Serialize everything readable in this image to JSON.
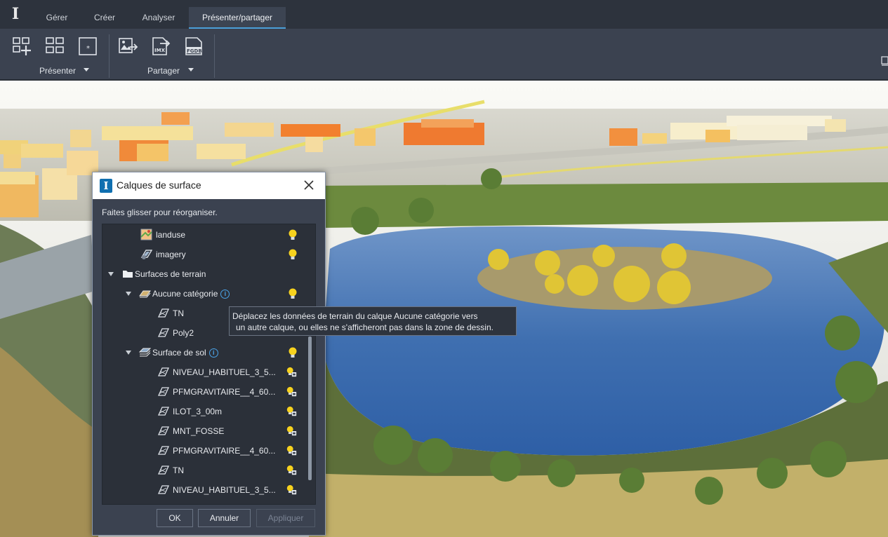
{
  "app": {
    "logo": "I"
  },
  "tabs": [
    {
      "label": "Gérer",
      "active": false
    },
    {
      "label": "Créer",
      "active": false
    },
    {
      "label": "Analyser",
      "active": false
    },
    {
      "label": "Présenter/partager",
      "active": true
    }
  ],
  "ribbon": {
    "groups": [
      {
        "label": "Présenter",
        "buttons": [
          "add-view-icon",
          "view-grid-icon",
          "snapshot-icon"
        ]
      },
      {
        "label": "Partager",
        "buttons": [
          "export-image-icon",
          "export-imx-icon",
          "export-fgdb-icon"
        ]
      }
    ],
    "imx_text": "IMX",
    "fgdb_text": "FGDB"
  },
  "dialog": {
    "title": "Calques de surface",
    "hint": "Faites glisser pour réorganiser.",
    "tree": [
      {
        "label": "landuse",
        "icon": "landuse-icon",
        "bulb": "on"
      },
      {
        "label": "imagery",
        "icon": "imagery-icon",
        "bulb": "on"
      },
      {
        "label": "Surfaces de terrain",
        "icon": "folder-icon",
        "bulb": "none"
      },
      {
        "label": "Aucune catégorie",
        "icon": "layer-icon",
        "bulb": "on",
        "info": "i"
      },
      {
        "label": "TN",
        "icon": "surface-icon",
        "bulb": "none"
      },
      {
        "label": "Poly2",
        "icon": "surface-icon",
        "bulb": "none"
      },
      {
        "label": "Surface de sol",
        "icon": "layer-stack-icon",
        "bulb": "on",
        "info": "i"
      },
      {
        "label": "NIVEAU_HABITUEL_3_5...",
        "icon": "surface-icon",
        "bulb": "locked"
      },
      {
        "label": "PFMGRAVITAIRE__4_60...",
        "icon": "surface-icon",
        "bulb": "locked"
      },
      {
        "label": "ILOT_3_00m",
        "icon": "surface-icon",
        "bulb": "locked"
      },
      {
        "label": "MNT_FOSSE",
        "icon": "surface-icon",
        "bulb": "locked"
      },
      {
        "label": "PFMGRAVITAIRE__4_60...",
        "icon": "surface-icon",
        "bulb": "locked"
      },
      {
        "label": "TN",
        "icon": "surface-icon",
        "bulb": "locked"
      },
      {
        "label": "NIVEAU_HABITUEL_3_5...",
        "icon": "surface-icon",
        "bulb": "locked"
      }
    ],
    "buttons": {
      "ok": "OK",
      "cancel": "Annuler",
      "apply": "Appliquer"
    }
  },
  "tooltip": {
    "line1": "Déplacez les données de terrain du calque Aucune catégorie vers",
    "line2": "un autre calque, ou elles ne s'afficheront pas dans la zone de dessin."
  },
  "colors": {
    "accent": "#4a9fd8",
    "bulb": "#f7d21e",
    "water": "#3f6fb0"
  }
}
